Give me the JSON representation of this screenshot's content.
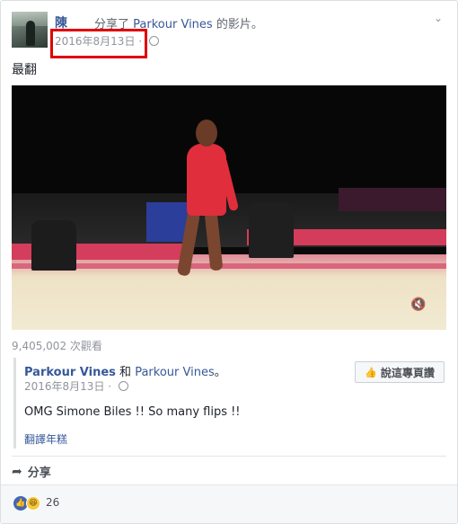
{
  "post": {
    "author": "陳",
    "shared_text": "分享了",
    "shared_page": "Parkour Vines",
    "shared_suffix": "的影片。",
    "date": "2016年8月13日",
    "separator": "·",
    "text": "最翻",
    "views": "9,405,002 次觀看"
  },
  "icons": {
    "globe": "globe-icon",
    "chevron": "chevron-down-icon",
    "mute": "mute-icon",
    "thumb": "thumb-up-icon",
    "share": "share-arrow-icon",
    "like_reaction": "like-reaction-icon",
    "haha_reaction": "haha-reaction-icon"
  },
  "original": {
    "page_name": "Parkour Vines",
    "conjunction": "和",
    "page_name2": "Parkour Vines",
    "suffix": "。",
    "date": "2016年8月13日",
    "separator": "·",
    "text": "OMG Simone Biles !! So many flips !!",
    "translate": "翻譯年糕",
    "like_page_label": "說這專頁讚"
  },
  "actions": {
    "share_label": "分享"
  },
  "reactions": {
    "count": "26"
  },
  "colors": {
    "link": "#365899",
    "highlight": "#e00000",
    "meta": "#90949c"
  }
}
